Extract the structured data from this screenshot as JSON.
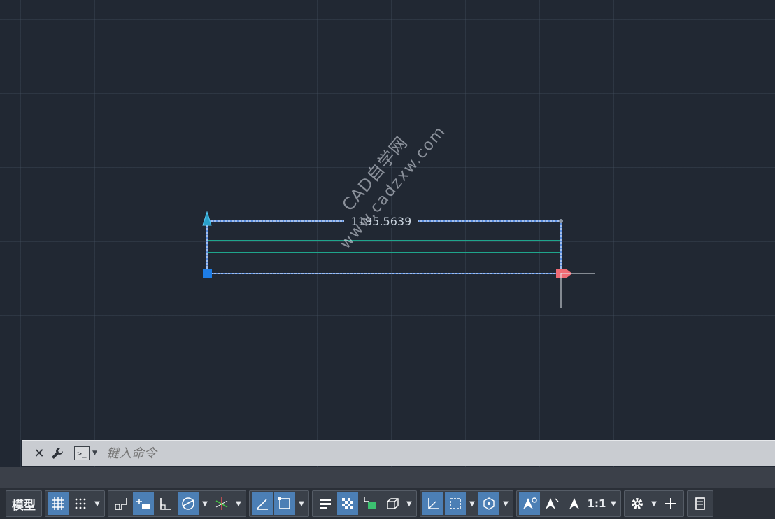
{
  "drawing": {
    "dimension_value": "1195.5639"
  },
  "watermark": {
    "line1": "CAD自学网",
    "line2": "www.cadzxw.com"
  },
  "command_line": {
    "placeholder": "键入命令",
    "close_icon": "✕",
    "customize_icon": "wrench-icon"
  },
  "status_bar": {
    "model_label": "模型",
    "scale_label": "1:1",
    "buttons": [
      {
        "name": "grid-display",
        "state": "on"
      },
      {
        "name": "snap-mode",
        "state": "off"
      },
      {
        "name": "infer-constraints",
        "state": "off"
      },
      {
        "name": "dynamic-input",
        "state": "on"
      },
      {
        "name": "ortho-mode",
        "state": "off"
      },
      {
        "name": "polar-tracking",
        "state": "on"
      },
      {
        "name": "isometric-drafting",
        "state": "off"
      },
      {
        "name": "object-snap-tracking",
        "state": "on"
      },
      {
        "name": "object-snap",
        "state": "on"
      },
      {
        "name": "lineweight",
        "state": "off"
      },
      {
        "name": "transparency",
        "state": "on"
      },
      {
        "name": "selection-cycling",
        "state": "off"
      },
      {
        "name": "3d-object-snap",
        "state": "off"
      },
      {
        "name": "dynamic-ucs",
        "state": "on"
      },
      {
        "name": "selection-filtering",
        "state": "on"
      },
      {
        "name": "gizmo",
        "state": "on"
      },
      {
        "name": "annotation-visibility",
        "state": "on"
      },
      {
        "name": "auto-scale",
        "state": "off"
      },
      {
        "name": "annotation-scale",
        "state": "off"
      }
    ]
  },
  "colors": {
    "background": "#212833",
    "selected_line": "#5b8fe0",
    "inner_line": "#1fa58c",
    "grip_blue": "#1e7de6",
    "grip_hot": "#f06b74",
    "button_on": "#4c7fb5"
  }
}
